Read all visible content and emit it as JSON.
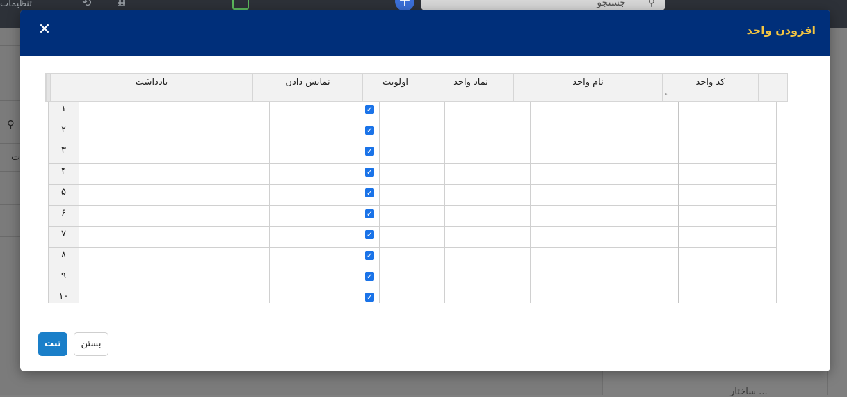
{
  "background": {
    "settings_label": "تنظیمات",
    "search_placeholder": "جستجو",
    "right_panel_text": "... ساختار"
  },
  "modal": {
    "title": "افزودن واحد",
    "close_icon": "close-icon",
    "columns": [
      "کد واحد",
      "نام واحد",
      "نماد واحد",
      "اولویت",
      "نمایش دادن",
      "یادداشت"
    ],
    "rows": [
      {
        "num": "۱",
        "show": true
      },
      {
        "num": "۲",
        "show": true
      },
      {
        "num": "۳",
        "show": true
      },
      {
        "num": "۴",
        "show": true
      },
      {
        "num": "۵",
        "show": true
      },
      {
        "num": "۶",
        "show": true
      },
      {
        "num": "۷",
        "show": true
      },
      {
        "num": "۸",
        "show": true
      },
      {
        "num": "۹",
        "show": true
      },
      {
        "num": "۱۰",
        "show": true
      }
    ],
    "buttons": {
      "submit": "ثبت",
      "close": "بستن"
    }
  },
  "colors": {
    "header_bg": "#002f7a",
    "title": "#f4c542",
    "primary": "#1a7fc9",
    "checkbox": "#1a73e8"
  }
}
